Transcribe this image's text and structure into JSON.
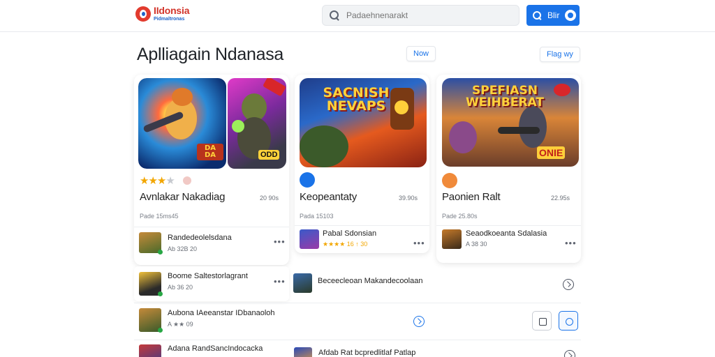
{
  "header": {
    "logo_title": "IIdonsia",
    "logo_sub": "Pidmaltronas",
    "search_placeholder": "Padaehnenarakt",
    "search_button_label": "Blir"
  },
  "page": {
    "title": "Aplliagain Ndanasa",
    "pill_new": "Now",
    "pill_flag": "Flag wy"
  },
  "cards": [
    {
      "name": "Avnlakar Nakadiag",
      "meta": "20 90s",
      "sub": "Pade 15ms45",
      "art_text": "DA DA",
      "art_tag": "ODD",
      "rating_stars": 3,
      "row_title": "Randedeolelsdana",
      "row_meta": "Ab 32B 20"
    },
    {
      "name": "Keopeantaty",
      "meta": "39.90s",
      "sub": "Pada 15103",
      "art_text": "SACNISH NEVAPS",
      "row_title": "Pabal Sdonsian",
      "row_meta": "★★★★ 16 ↑ 30",
      "rating_stars": 4
    },
    {
      "name": "Paonien Ralt",
      "meta": "22.95s",
      "sub": "Pade 25.80s",
      "art_text": "SPEFIASN WEIHBERAT",
      "art_tag": "ONIE",
      "row_title": "Seaodkoeanta Sdalasia",
      "row_meta": "A 38 30"
    }
  ],
  "list": [
    {
      "title": "Boome Saltestorlagrant",
      "meta": "Ab 36 20",
      "mid_title": "Beceecleoan Makandecoolaan"
    },
    {
      "title": "Aubona IAeeanstar IDbanaoloh",
      "meta": "A ★★ 09",
      "rating_stars": 2
    },
    {
      "title": "Adana RandSancIndocacka",
      "mid_title": "Afdab Rat bcpredlitlaf Patlap"
    }
  ],
  "colors": {
    "accent": "#1a73e8",
    "star": "#f2a600",
    "logo_red": "#d2342a"
  }
}
